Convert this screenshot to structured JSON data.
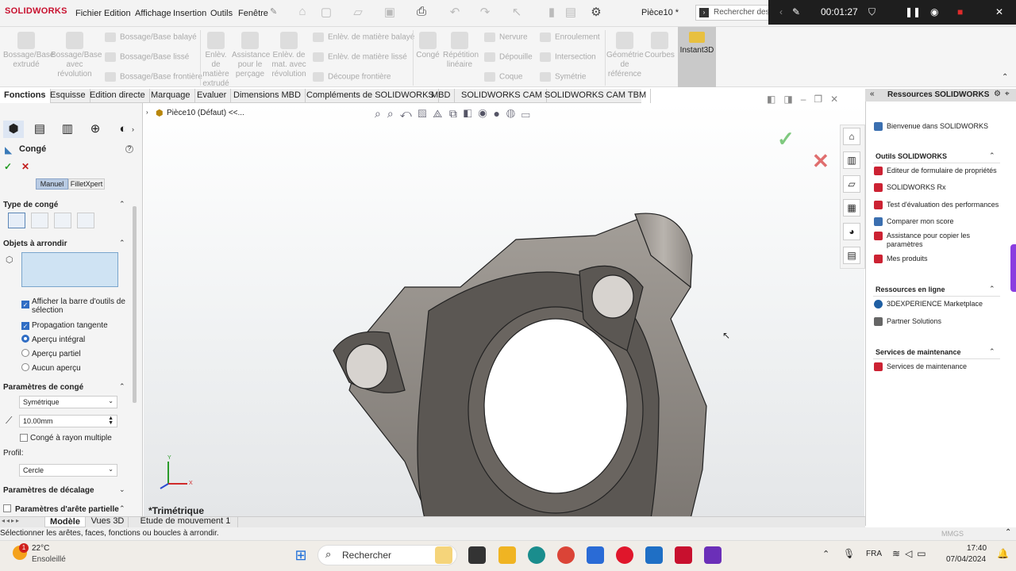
{
  "app": {
    "logo": "SOLIDWORKS",
    "doc_title": "Pièce10 *",
    "search_placeholder": "Rechercher des c"
  },
  "menu": [
    "Fichier",
    "Edition",
    "Affichage",
    "Insertion",
    "Outils",
    "Fenêtre"
  ],
  "recorder": {
    "timer": "00:01:27"
  },
  "ribbon": {
    "bossage_extrude": "Bossage/Base extrudé",
    "bossage_revolution": "Bossage/Base avec révolution",
    "bossage_balaye": "Bossage/Base balayé",
    "bossage_lisse": "Bossage/Base lissé",
    "bossage_frontiere": "Bossage/Base frontière",
    "enlev_extrude": "Enlèv. de matière extrudé",
    "assistance_percage": "Assistance pour le perçage",
    "enlev_revolution": "Enlèv. de mat. avec révolution",
    "enlev_balaye": "Enlèv. de matière balayé",
    "enlev_lisse": "Enlèv. de matière lissé",
    "decoupe_frontiere": "Découpe frontière",
    "conge": "Congé",
    "repetition": "Répétition linéaire",
    "nervure": "Nervure",
    "depouille": "Dépouille",
    "coque": "Coque",
    "enroulement": "Enroulement",
    "intersection": "Intersection",
    "symetrie": "Symétrie",
    "geometrie_ref": "Géométrie de référence",
    "courbes": "Courbes",
    "instant3d": "Instant3D"
  },
  "tabs": [
    "Fonctions",
    "Esquisse",
    "Edition directe",
    "Marquage",
    "Evaluer",
    "Dimensions MBD",
    "Compléments de SOLIDWORKS",
    "MBD",
    "SOLIDWORKS CAM",
    "SOLIDWORKS CAM TBM"
  ],
  "property_manager": {
    "title": "Congé",
    "mode_manual": "Manuel",
    "mode_filletxpert": "FilletXpert",
    "type_section": "Type de congé",
    "items_section": "Objets à arrondir",
    "show_toolbar": "Afficher la barre d'outils de sélection",
    "tangent_propagation": "Propagation tangente",
    "preview_full": "Aperçu intégral",
    "preview_partial": "Aperçu partiel",
    "preview_none": "Aucun aperçu",
    "params_section": "Paramètres de congé",
    "symmetry": "Symétrique",
    "radius": "10.00mm",
    "multi_radius": "Congé à rayon multiple",
    "profile_label": "Profil:",
    "profile": "Cercle",
    "offset_section": "Paramètres de décalage",
    "partial_edge_section": "Paramètres d'arête partielle"
  },
  "viewport": {
    "breadcrumb": "Pièce10 (Défaut) <<...",
    "view_label": "*Trimétrique",
    "axis_y": "Y",
    "axis_x": "X"
  },
  "task_pane": {
    "title": "Ressources SOLIDWORKS",
    "welcome": "Bienvenue dans SOLIDWORKS",
    "tools_section": "Outils SOLIDWORKS",
    "tools": [
      "Editeur de formulaire de propriétés",
      "SOLIDWORKS Rx",
      "Test d'évaluation des performances",
      "Comparer mon score",
      "Assistance pour copier les paramètres",
      "Mes produits"
    ],
    "online_section": "Ressources en ligne",
    "online": [
      "3DEXPERIENCE Marketplace",
      "Partner Solutions"
    ],
    "maintenance_section": "Services de maintenance",
    "maintenance": [
      "Services de maintenance"
    ]
  },
  "bottom_tabs": [
    "Modèle",
    "Vues 3D",
    "Etude de mouvement 1"
  ],
  "status": {
    "message": "Sélectionner les arêtes, faces, fonctions ou boucles à arrondir.",
    "units": "MMGS"
  },
  "taskbar": {
    "temperature": "22°C",
    "weather": "Ensoleillé",
    "search": "Rechercher",
    "language": "FRA",
    "time": "17:40",
    "date": "07/04/2024",
    "notification_count": "1"
  }
}
